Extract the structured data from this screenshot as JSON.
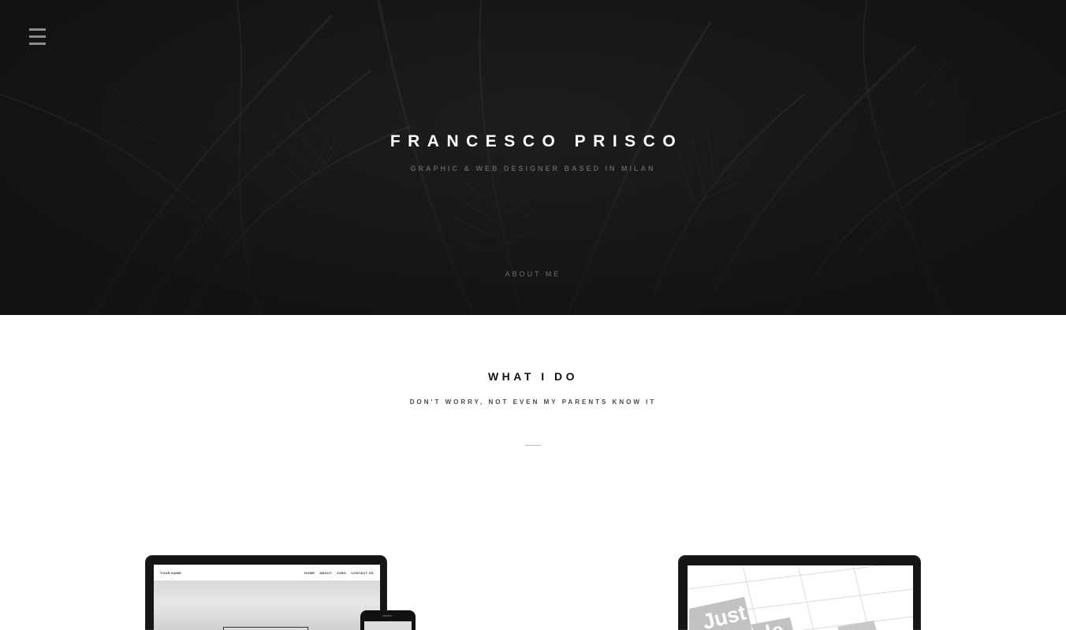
{
  "hero": {
    "title": "FRANCESCO PRISCO",
    "subtitle": "GRAPHIC & WEB DESIGNER BASED IN MILAN",
    "about_link": "ABOUT ME",
    "menu_icon": "hamburger-menu-icon"
  },
  "section": {
    "title": "WHAT I DO",
    "subtitle": "DON'T WORRY, NOT EVEN MY PARENTS KNOW IT"
  },
  "mockup_left": {
    "brand": "YOUR NAME",
    "nav": [
      "HOME",
      "ABOUT",
      "JOBS",
      "CONTACT US"
    ]
  },
  "mockup_right": {
    "text_1": "Just",
    "text_2": "ple"
  },
  "colors": {
    "hero_bg": "#1c1c1c",
    "title": "#ffffff",
    "subtitle": "#5f5f5f",
    "section_title": "#111111"
  }
}
